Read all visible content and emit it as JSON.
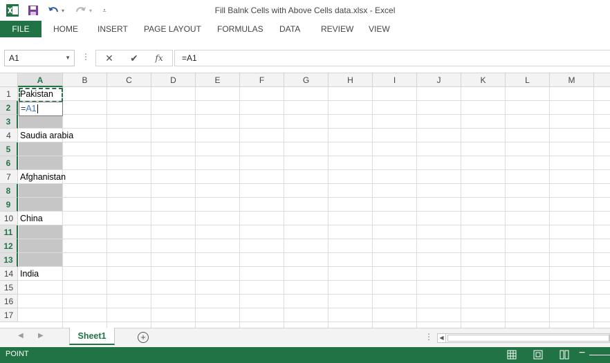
{
  "window": {
    "title": "Fill Balnk Cells with Above Cells data.xlsx - Excel"
  },
  "quick_access": {
    "icons": [
      "excel-logo-icon",
      "save-icon",
      "undo-icon",
      "redo-icon",
      "customize-qat-icon"
    ]
  },
  "ribbon": {
    "tabs": [
      "FILE",
      "HOME",
      "INSERT",
      "PAGE LAYOUT",
      "FORMULAS",
      "DATA",
      "REVIEW",
      "VIEW"
    ],
    "active_tab": "FILE"
  },
  "formula_bar": {
    "name_box": "A1",
    "formula": "=A1",
    "fx_label": "fx"
  },
  "grid": {
    "columns": [
      "A",
      "B",
      "C",
      "D",
      "E",
      "F",
      "G",
      "H",
      "I",
      "J",
      "K",
      "L",
      "M"
    ],
    "selected_column": "A",
    "rows": [
      "1",
      "2",
      "3",
      "4",
      "5",
      "6",
      "7",
      "8",
      "9",
      "10",
      "11",
      "12",
      "13",
      "14",
      "15",
      "16",
      "17"
    ],
    "selected_rows": [
      "2",
      "3",
      "5",
      "6",
      "8",
      "9",
      "11",
      "12",
      "13"
    ],
    "cells": [
      {
        "ref": "A1",
        "value": "Pakistan"
      },
      {
        "ref": "A4",
        "value": "Saudia arabia"
      },
      {
        "ref": "A7",
        "value": "Afghanistan"
      },
      {
        "ref": "A10",
        "value": "China"
      },
      {
        "ref": "A14",
        "value": "India"
      }
    ],
    "editing": {
      "ref": "A2",
      "prefix": "=",
      "reference": "A1"
    }
  },
  "sheets": {
    "tabs": [
      "Sheet1"
    ],
    "active": "Sheet1",
    "add_label": "+"
  },
  "status": {
    "mode": "POINT"
  },
  "colors": {
    "accent": "#217346",
    "selection_fill": "#c6c6c6",
    "reference_blue": "#3f72c4"
  }
}
